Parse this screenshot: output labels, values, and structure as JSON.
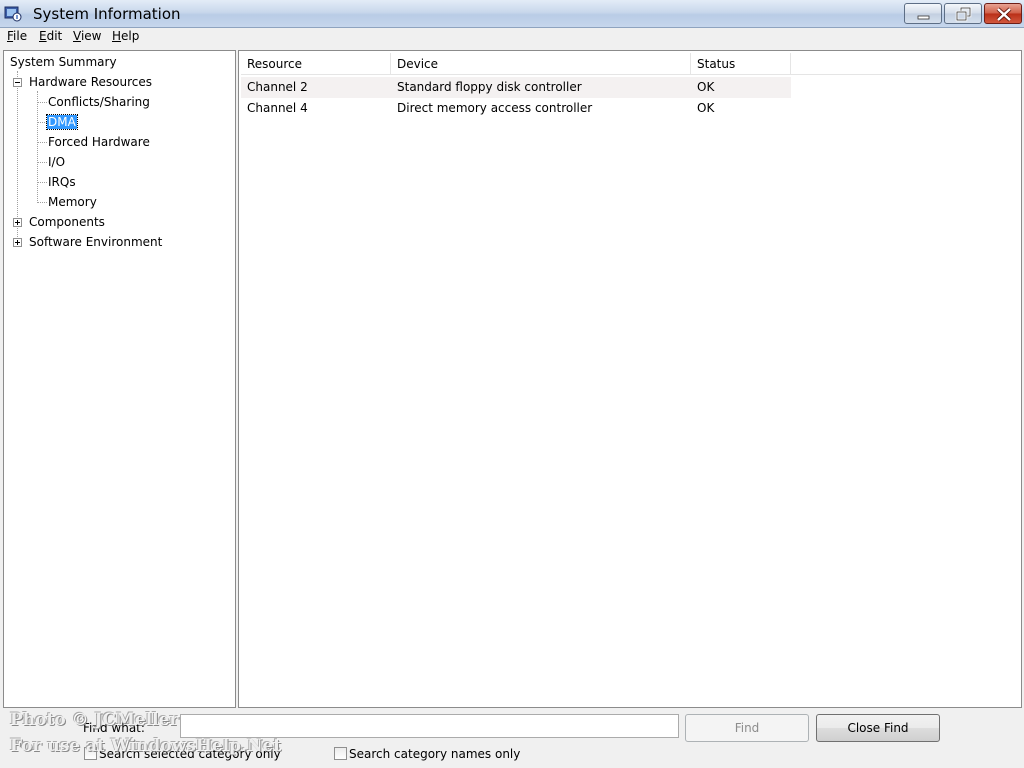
{
  "window": {
    "title": "System Information"
  },
  "menu": [
    {
      "label": "File",
      "key": "F",
      "rest": "ile"
    },
    {
      "label": "Edit",
      "key": "E",
      "rest": "dit"
    },
    {
      "label": "View",
      "key": "V",
      "rest": "iew"
    },
    {
      "label": "Help",
      "key": "H",
      "rest": "elp"
    }
  ],
  "tree": {
    "root": "System Summary",
    "hardware": "Hardware Resources",
    "hardware_children": [
      "Conflicts/Sharing",
      "DMA",
      "Forced Hardware",
      "I/O",
      "IRQs",
      "Memory"
    ],
    "selected": "DMA",
    "components": "Components",
    "software": "Software Environment"
  },
  "table": {
    "columns": [
      "Resource",
      "Device",
      "Status"
    ],
    "rows": [
      [
        "Channel 2",
        "Standard floppy disk controller",
        "OK"
      ],
      [
        "Channel 4",
        "Direct memory access controller",
        "OK"
      ]
    ]
  },
  "find": {
    "label": "Find what:",
    "value": "",
    "find_button": "Find",
    "close_button": "Close Find",
    "search_selected_label": "Search selected category only",
    "search_names_label": "Search category names only"
  },
  "watermark": {
    "line1": "Photo © JCMeller",
    "line2": "For use at WindowsHelp.Net"
  }
}
